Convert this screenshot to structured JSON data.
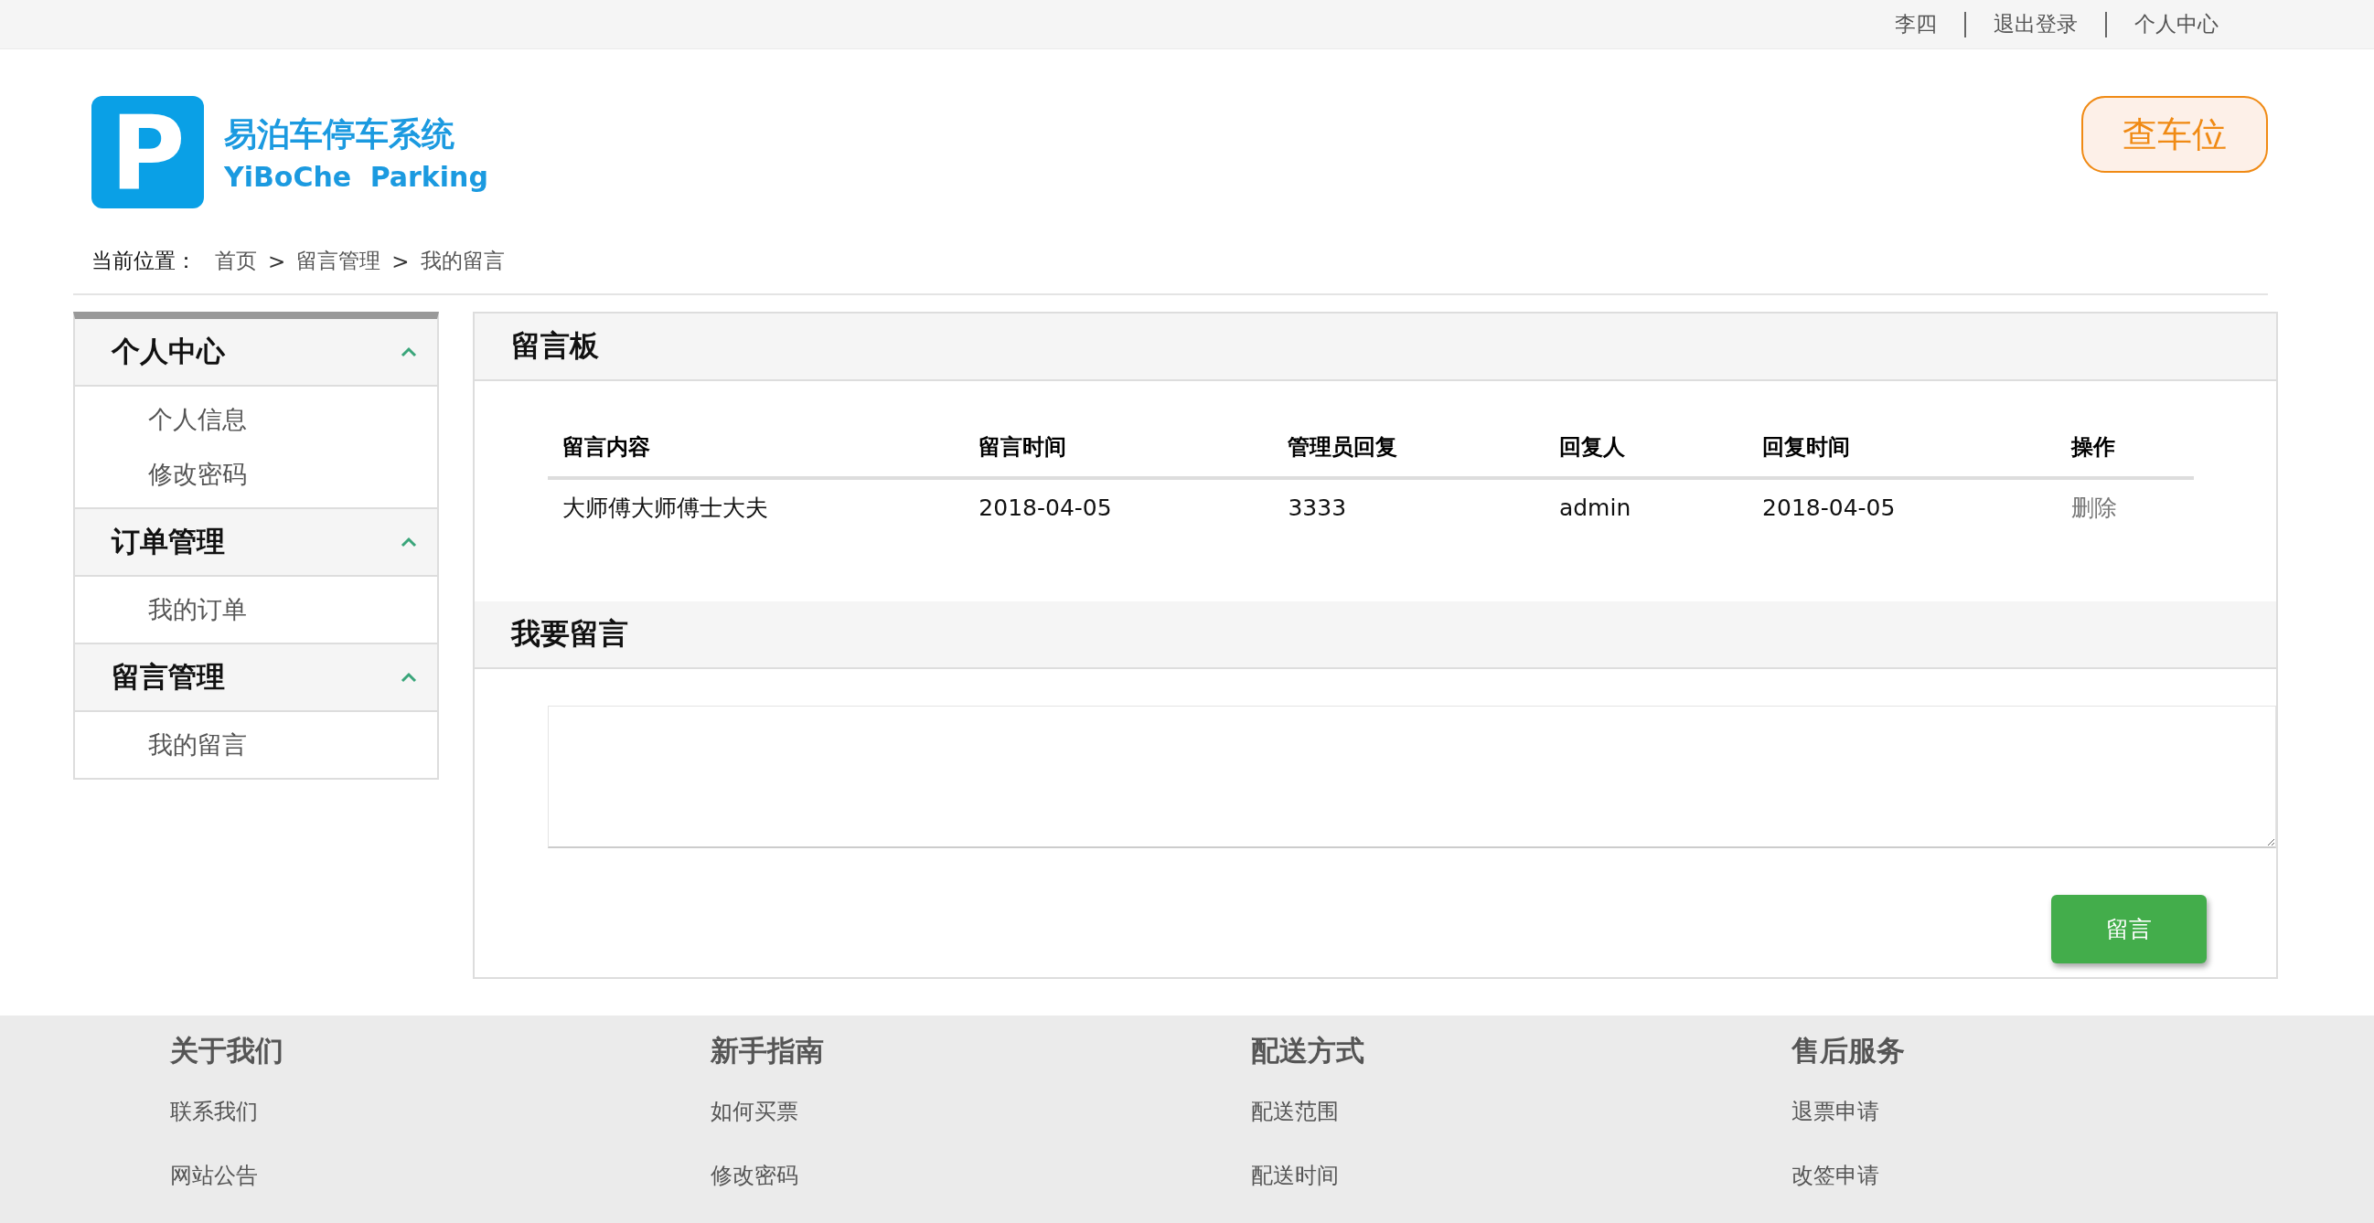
{
  "top_bar": {
    "links": [
      {
        "label": "李四"
      },
      {
        "label": "退出登录"
      },
      {
        "label": "个人中心"
      }
    ]
  },
  "logo": {
    "icon_letter": "P",
    "title": "易泊车停车系统",
    "subtitle": "YiBoChe Parking"
  },
  "find_spot_button": {
    "label": "查车位"
  },
  "breadcrumb": {
    "label": "当前位置：",
    "path": [
      "首页",
      "留言管理",
      "我的留言"
    ],
    "separators": [
      ">",
      ">"
    ]
  },
  "sidebar": {
    "groups": [
      {
        "title": "个人中心",
        "expanded": true,
        "items": [
          {
            "label": "个人信息"
          },
          {
            "label": "修改密码"
          }
        ]
      },
      {
        "title": "订单管理",
        "expanded": true,
        "items": [
          {
            "label": "我的订单"
          }
        ]
      },
      {
        "title": "留言管理",
        "expanded": true,
        "items": [
          {
            "label": "我的留言"
          }
        ]
      }
    ]
  },
  "message_board": {
    "title": "留言板",
    "table": {
      "columns": [
        "留言内容",
        "留言时间",
        "管理员回复",
        "回复人",
        "回复时间",
        "操作"
      ],
      "rows": [
        {
          "cells": [
            "大师傅大师傅士大夫",
            "2018-04-05",
            "3333",
            "admin",
            "2018-04-05"
          ],
          "action": "删除"
        }
      ]
    }
  },
  "compose": {
    "title": "我要留言",
    "submit": "留言"
  },
  "footer": {
    "columns": [
      {
        "title": "关于我们",
        "links": [
          "联系我们",
          "网站公告"
        ]
      },
      {
        "title": "新手指南",
        "links": [
          "如何买票",
          "修改密码"
        ]
      },
      {
        "title": "配送方式",
        "links": [
          "配送范围",
          "配送时间"
        ]
      },
      {
        "title": "售后服务",
        "links": [
          "退票申请",
          "改签申请"
        ]
      }
    ]
  }
}
